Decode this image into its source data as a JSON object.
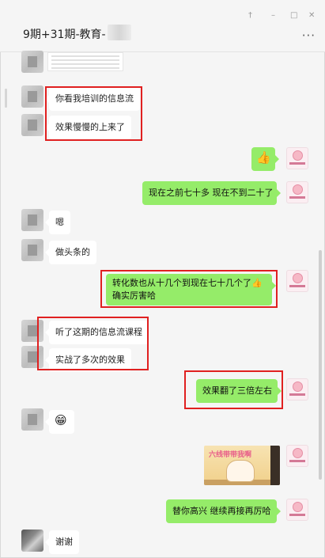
{
  "window": {
    "title": "9期+31期-教育-",
    "pin_icon": "pin-icon",
    "minimize_icon": "minimize-icon",
    "maximize_icon": "maximize-icon",
    "close_icon": "close-icon",
    "more_icon": "more-icon"
  },
  "messages": [
    {
      "id": 1,
      "side": "left",
      "type": "image",
      "image": "screenshot-thumbnail"
    },
    {
      "id": 2,
      "side": "left",
      "type": "text",
      "text": "你看我培训的信息流"
    },
    {
      "id": 3,
      "side": "left",
      "type": "text",
      "text": "效果慢慢的上来了"
    },
    {
      "id": 4,
      "side": "right",
      "type": "emoji",
      "emoji": "👍"
    },
    {
      "id": 5,
      "side": "right",
      "type": "text",
      "text": "现在之前七十多  现在不到二十了"
    },
    {
      "id": 6,
      "side": "left",
      "type": "text",
      "text": "嗯"
    },
    {
      "id": 7,
      "side": "left",
      "type": "text",
      "text": "做头条的"
    },
    {
      "id": 8,
      "side": "right",
      "type": "text",
      "lines": [
        "转化数也从十几个到现在七十几个了👍",
        "确实厉害哈"
      ]
    },
    {
      "id": 9,
      "side": "left",
      "type": "text",
      "text": "听了这期的信息流课程"
    },
    {
      "id": 10,
      "side": "left",
      "type": "text",
      "text": "实战了多次的效果"
    },
    {
      "id": 11,
      "side": "right",
      "type": "text",
      "text": "效果翻了三倍左右"
    },
    {
      "id": 12,
      "side": "left",
      "type": "emoji",
      "emoji": "😁"
    },
    {
      "id": 13,
      "side": "right",
      "type": "sticker",
      "caption": "六线带带我啊"
    },
    {
      "id": 14,
      "side": "right",
      "type": "text",
      "text": "替你高兴  继续再接再厉哈"
    },
    {
      "id": 15,
      "side": "left",
      "type": "text",
      "text": "谢谢"
    }
  ],
  "colors": {
    "outgoing_bubble": "#95ec69",
    "incoming_bubble": "#ffffff",
    "highlight_box": "#e02020",
    "background": "#f5f5f5"
  }
}
